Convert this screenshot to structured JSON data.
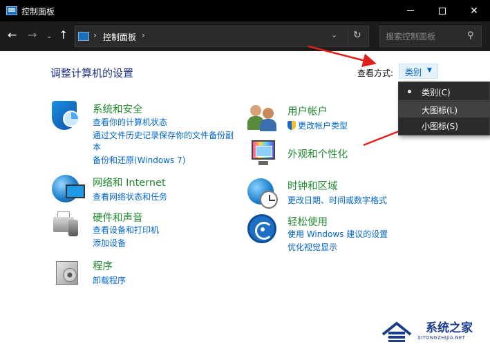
{
  "window": {
    "title": "控制面板",
    "controls": {
      "minimize": "minimize",
      "maximize": "maximize",
      "close": "✕"
    }
  },
  "nav": {
    "breadcrumb": "控制面板",
    "search_placeholder": "搜索控制面板"
  },
  "content": {
    "heading": "调整计算机的设置",
    "view_by_label": "查看方式:",
    "view_by_value": "类别"
  },
  "view_menu": {
    "items": [
      {
        "label": "类别(C)",
        "selected": true
      },
      {
        "label": "大图标(L)",
        "selected": false,
        "hovered": true
      },
      {
        "label": "小图标(S)",
        "selected": false
      }
    ]
  },
  "categories_left": [
    {
      "title": "系统和安全",
      "icon": "shield-icon",
      "links": [
        "查看你的计算机状态",
        "通过文件历史记录保存你的文件备份副",
        "本",
        "备份和还原(Windows 7)"
      ]
    },
    {
      "title": "网络和 Internet",
      "icon": "network-globe-icon",
      "links": [
        "查看网络状态和任务"
      ]
    },
    {
      "title": "硬件和声音",
      "icon": "printer-icon",
      "links": [
        "查看设备和打印机",
        "添加设备"
      ]
    },
    {
      "title": "程序",
      "icon": "programs-icon",
      "links": [
        "卸载程序"
      ]
    }
  ],
  "categories_right": [
    {
      "title": "用户帐户",
      "icon": "user-accounts-icon",
      "links": [
        "更改帐户类型"
      ]
    },
    {
      "title": "外观和个性化",
      "icon": "appearance-icon",
      "links": []
    },
    {
      "title": "时钟和区域",
      "icon": "clock-globe-icon",
      "links": [
        "更改日期、时间或数字格式"
      ]
    },
    {
      "title": "轻松使用",
      "icon": "ease-of-access-icon",
      "links": [
        "使用 Windows 建议的设置",
        "优化视觉显示"
      ]
    }
  ],
  "watermark": {
    "name": "系统之家",
    "url": "XITONGZHIJIA.NET"
  },
  "colors": {
    "title_bar": "#000000",
    "category_title": "#1f8a2e",
    "link": "#0066cc",
    "heading": "#1e3287",
    "annotation_arrow": "#e0201c"
  }
}
